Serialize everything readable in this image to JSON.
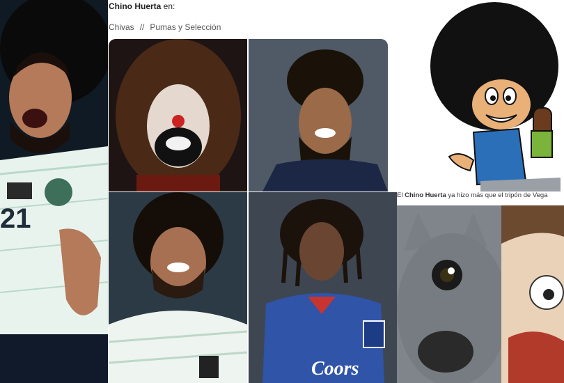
{
  "header": {
    "name": "Chino Huerta",
    "suffix": " en:",
    "team_left": "Chivas",
    "separator": "//",
    "team_right": "Pumas y Selección"
  },
  "caption": {
    "name": "Chino Huerta",
    "prefix": "El ",
    "text": " ya hizo más que el tripón de Vega"
  },
  "photos": {
    "player_celebrating": "21",
    "blue_jersey_sponsor": "Coors"
  },
  "colors": {
    "grid_border": "#e6ecf0",
    "mexico_jersey": "#e9f3ee",
    "chelsea_blue": "#2f54a8"
  }
}
